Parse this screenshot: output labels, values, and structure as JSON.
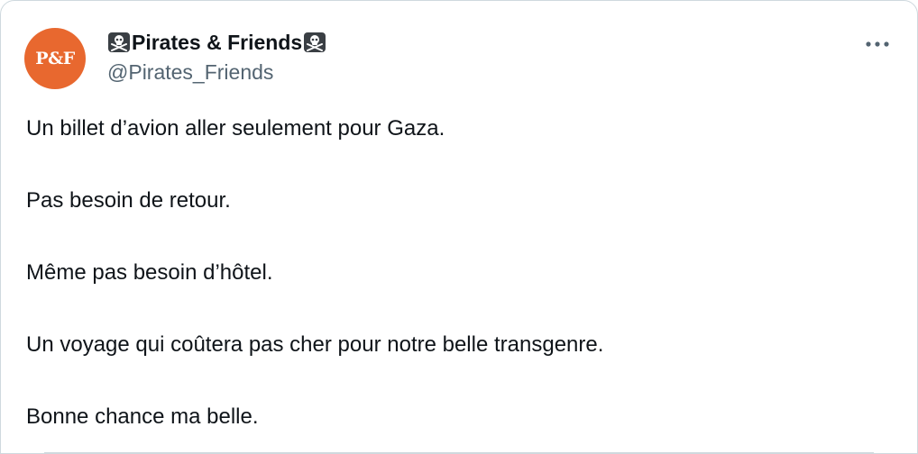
{
  "tweet": {
    "author": {
      "avatar_text": "P&F",
      "avatar_color": "#e8682f",
      "leading_emoji": "skull-and-crossbones-icon",
      "name": "Pirates & Friends",
      "trailing_emoji": "skull-and-crossbones-icon",
      "handle": "@Pirates_Friends"
    },
    "more_icon": "more-horizontal-icon",
    "lines": [
      "Un billet d’avion aller seulement pour Gaza.",
      "Pas besoin de retour.",
      "Même pas besoin d’hôtel.",
      "Un voyage qui coûtera pas cher pour notre belle transgenre.",
      "Bonne chance ma belle."
    ]
  },
  "colors": {
    "text_primary": "#0f1419",
    "text_secondary": "#536471",
    "border": "#cfd9de"
  }
}
